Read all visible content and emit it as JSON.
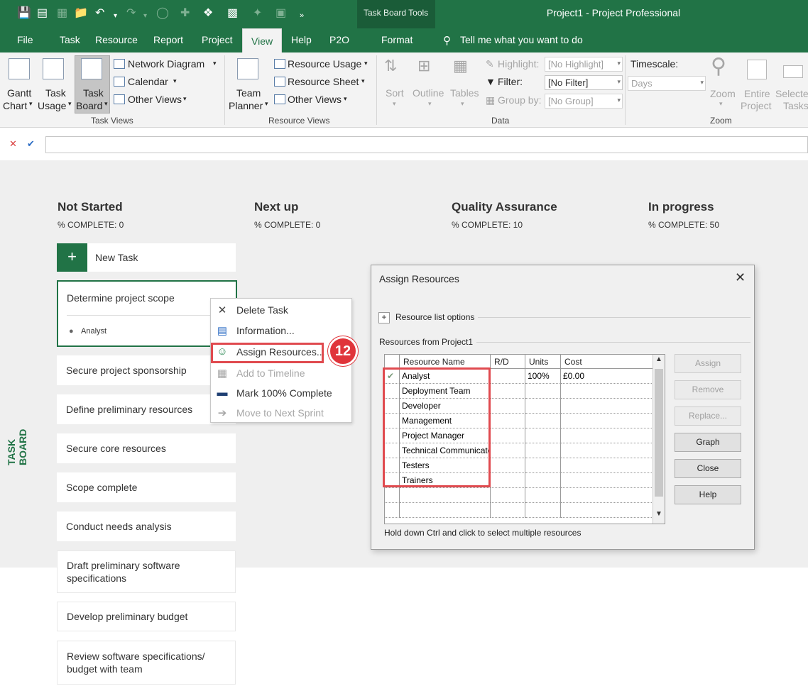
{
  "qat": {
    "save_icon": "save-icon",
    "undo_icon": "undo-icon",
    "more": "»"
  },
  "title": {
    "context_tab": "Task Board Tools",
    "window": "Project1  -  Project Professional"
  },
  "tabs": [
    "File",
    "Task",
    "Resource",
    "Report",
    "Project",
    "View",
    "Help",
    "P2O",
    "Format"
  ],
  "active_tab": "View",
  "tell_me": "Tell me what you want to do",
  "ribbon": {
    "task_views": {
      "gantt_line1": "Gantt",
      "gantt_line2": "Chart",
      "usage_line1": "Task",
      "usage_line2": "Usage",
      "board_line1": "Task",
      "board_line2": "Board",
      "network": "Network Diagram",
      "calendar": "Calendar",
      "other": "Other Views",
      "label": "Task Views"
    },
    "resource_views": {
      "team_line1": "Team",
      "team_line2": "Planner",
      "usage": "Resource Usage",
      "sheet": "Resource Sheet",
      "other": "Other Views",
      "label": "Resource Views"
    },
    "data": {
      "sort": "Sort",
      "outline": "Outline",
      "tables": "Tables",
      "highlight_label": "Highlight:",
      "highlight_value": "[No Highlight]",
      "filter_label": "Filter:",
      "filter_value": "[No Filter]",
      "group_label": "Group by:",
      "group_value": "[No Group]",
      "label": "Data"
    },
    "zoom": {
      "timescale_label": "Timescale:",
      "timescale_value": "Days",
      "zoom": "Zoom",
      "entire_line1": "Entire",
      "entire_line2": "Project",
      "selected_line1": "Selecte",
      "selected_line2": "Tasks",
      "label": "Zoom"
    }
  },
  "formula": {
    "cancel": "✕",
    "confirm": "✔"
  },
  "board": {
    "side_label": "TASK BOARD",
    "columns": [
      {
        "title": "Not Started",
        "pct": "% COMPLETE: 0"
      },
      {
        "title": "Next up",
        "pct": "% COMPLETE: 0"
      },
      {
        "title": "Quality Assurance",
        "pct": "% COMPLETE: 10"
      },
      {
        "title": "In progress",
        "pct": "% COMPLETE: 50"
      }
    ],
    "new_task": "New Task",
    "selected_card": {
      "title": "Determine project scope",
      "resource": "Analyst"
    },
    "cards": [
      "Secure project sponsorship",
      "Define preliminary resources",
      "Secure core resources",
      "Scope complete",
      "Conduct needs analysis",
      "Draft preliminary software specifications",
      "Develop preliminary budget",
      "Review software specifications/ budget with team"
    ]
  },
  "context_menu": {
    "items": [
      {
        "label": "Delete Task",
        "icon": "✕",
        "enabled": true
      },
      {
        "label": "Information...",
        "icon": "▤",
        "enabled": true
      },
      {
        "label": "Assign Resources...",
        "icon": "☺",
        "enabled": true
      },
      {
        "label": "Add to Timeline",
        "icon": "▦",
        "enabled": false
      },
      {
        "label": "Mark 100% Complete",
        "icon": "▬",
        "enabled": true
      },
      {
        "label": "Move to Next Sprint",
        "icon": "➔",
        "enabled": false
      }
    ],
    "step_badge": "12",
    "accent": "#e0343a"
  },
  "dialog": {
    "title": "Assign Resources",
    "close": "✕",
    "resource_list_options": "Resource list options",
    "resources_from": "Resources from Project1",
    "columns": [
      "Resource Name",
      "R/D",
      "Units",
      "Cost"
    ],
    "rows": [
      {
        "name": "Analyst",
        "rd": "",
        "units": "100%",
        "cost": "£0.00",
        "check": "✔"
      },
      {
        "name": "Deployment Team",
        "rd": "",
        "units": "",
        "cost": "",
        "check": ""
      },
      {
        "name": "Developer",
        "rd": "",
        "units": "",
        "cost": "",
        "check": ""
      },
      {
        "name": "Management",
        "rd": "",
        "units": "",
        "cost": "",
        "check": ""
      },
      {
        "name": "Project Manager",
        "rd": "",
        "units": "",
        "cost": "",
        "check": ""
      },
      {
        "name": "Technical Communicato",
        "rd": "",
        "units": "",
        "cost": "",
        "check": ""
      },
      {
        "name": "Testers",
        "rd": "",
        "units": "",
        "cost": "",
        "check": ""
      },
      {
        "name": "Trainers",
        "rd": "",
        "units": "",
        "cost": "",
        "check": ""
      },
      {
        "name": "",
        "rd": "",
        "units": "",
        "cost": "",
        "check": ""
      },
      {
        "name": "",
        "rd": "",
        "units": "",
        "cost": "",
        "check": ""
      }
    ],
    "buttons": {
      "assign": "Assign",
      "remove": "Remove",
      "replace": "Replace...",
      "graph": "Graph",
      "close": "Close",
      "help": "Help"
    },
    "hint": "Hold down Ctrl and click to select multiple resources"
  },
  "colors": {
    "brand": "#217346",
    "callout": "#e04a4f"
  }
}
